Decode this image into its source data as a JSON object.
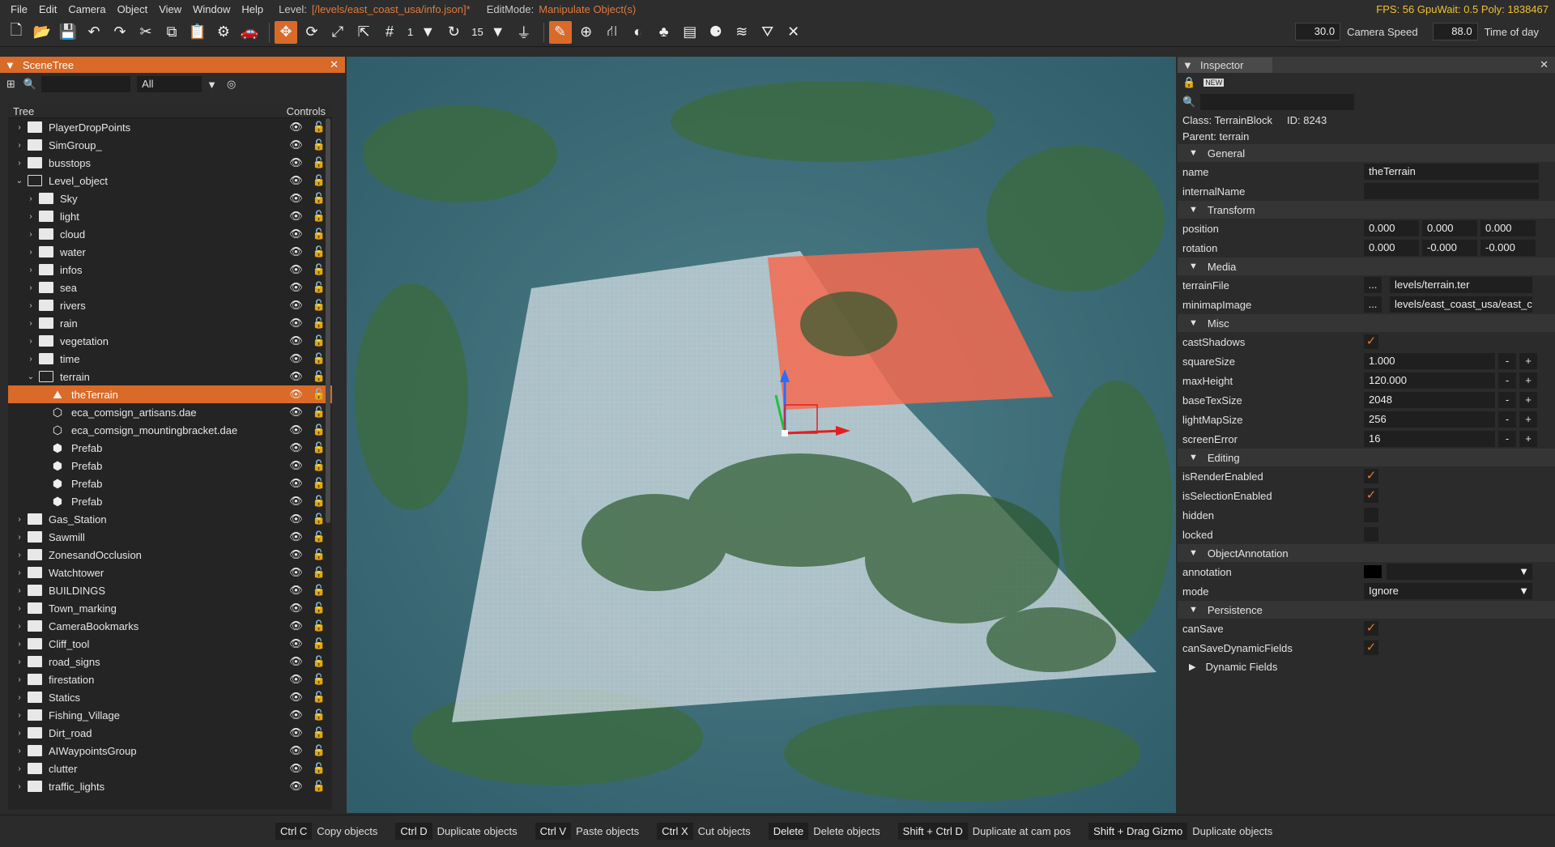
{
  "menu": {
    "items": [
      "File",
      "Edit",
      "Camera",
      "Object",
      "View",
      "Window",
      "Help"
    ],
    "level_label": "Level:",
    "level_path": "[/levels/east_coast_usa/info.json]*",
    "editmode_label": "EditMode:",
    "editmode_value": "Manipulate Object(s)",
    "stats": "FPS: 56  GpuWait: 0.5  Poly: 1838467"
  },
  "toolbar": {
    "snap_value": "1",
    "rot_snap_value": "15",
    "camera_speed_value": "30.0",
    "camera_speed_label": "Camera Speed",
    "time_value": "88.0",
    "time_label": "Time of day"
  },
  "scenetree": {
    "title": "SceneTree",
    "filter": "All",
    "col_tree": "Tree",
    "col_controls": "Controls",
    "rows": [
      {
        "label": "PlayerDropPoints",
        "depth": 0,
        "arrow": "right",
        "icon": "folder"
      },
      {
        "label": "SimGroup_",
        "depth": 0,
        "arrow": "right",
        "icon": "folder"
      },
      {
        "label": "busstops",
        "depth": 0,
        "arrow": "right",
        "icon": "folder"
      },
      {
        "label": "Level_object",
        "depth": 0,
        "arrow": "down",
        "icon": "folder-open"
      },
      {
        "label": "Sky",
        "depth": 1,
        "arrow": "right",
        "icon": "folder"
      },
      {
        "label": "light",
        "depth": 1,
        "arrow": "right",
        "icon": "folder"
      },
      {
        "label": "cloud",
        "depth": 1,
        "arrow": "right",
        "icon": "folder"
      },
      {
        "label": "water",
        "depth": 1,
        "arrow": "right",
        "icon": "folder"
      },
      {
        "label": "infos",
        "depth": 1,
        "arrow": "right",
        "icon": "folder"
      },
      {
        "label": "sea",
        "depth": 1,
        "arrow": "right",
        "icon": "folder"
      },
      {
        "label": "rivers",
        "depth": 1,
        "arrow": "right",
        "icon": "folder"
      },
      {
        "label": "rain",
        "depth": 1,
        "arrow": "right",
        "icon": "folder"
      },
      {
        "label": "vegetation",
        "depth": 1,
        "arrow": "right",
        "icon": "folder"
      },
      {
        "label": "time",
        "depth": 1,
        "arrow": "right",
        "icon": "folder"
      },
      {
        "label": "terrain",
        "depth": 1,
        "arrow": "down",
        "icon": "folder-open"
      },
      {
        "label": "theTerrain",
        "depth": 2,
        "arrow": "",
        "icon": "terrain",
        "selected": true
      },
      {
        "label": "eca_comsign_artisans.dae",
        "depth": 2,
        "arrow": "",
        "icon": "mesh"
      },
      {
        "label": "eca_comsign_mountingbracket.dae",
        "depth": 2,
        "arrow": "",
        "icon": "mesh"
      },
      {
        "label": "Prefab",
        "depth": 2,
        "arrow": "",
        "icon": "prefab"
      },
      {
        "label": "Prefab",
        "depth": 2,
        "arrow": "",
        "icon": "prefab"
      },
      {
        "label": "Prefab",
        "depth": 2,
        "arrow": "",
        "icon": "prefab"
      },
      {
        "label": "Prefab",
        "depth": 2,
        "arrow": "",
        "icon": "prefab"
      },
      {
        "label": "Gas_Station",
        "depth": 0,
        "arrow": "right",
        "icon": "folder"
      },
      {
        "label": "Sawmill",
        "depth": 0,
        "arrow": "right",
        "icon": "folder"
      },
      {
        "label": "ZonesandOcclusion",
        "depth": 0,
        "arrow": "right",
        "icon": "folder"
      },
      {
        "label": "Watchtower",
        "depth": 0,
        "arrow": "right",
        "icon": "folder"
      },
      {
        "label": "BUILDINGS",
        "depth": 0,
        "arrow": "right",
        "icon": "folder"
      },
      {
        "label": "Town_marking",
        "depth": 0,
        "arrow": "right",
        "icon": "folder"
      },
      {
        "label": "CameraBookmarks",
        "depth": 0,
        "arrow": "right",
        "icon": "folder"
      },
      {
        "label": "Cliff_tool",
        "depth": 0,
        "arrow": "right",
        "icon": "folder"
      },
      {
        "label": "road_signs",
        "depth": 0,
        "arrow": "right",
        "icon": "folder"
      },
      {
        "label": "firestation",
        "depth": 0,
        "arrow": "right",
        "icon": "folder"
      },
      {
        "label": "Statics",
        "depth": 0,
        "arrow": "right",
        "icon": "folder"
      },
      {
        "label": "Fishing_Village",
        "depth": 0,
        "arrow": "right",
        "icon": "folder"
      },
      {
        "label": "Dirt_road",
        "depth": 0,
        "arrow": "right",
        "icon": "folder"
      },
      {
        "label": "AIWaypointsGroup",
        "depth": 0,
        "arrow": "right",
        "icon": "folder"
      },
      {
        "label": "clutter",
        "depth": 0,
        "arrow": "right",
        "icon": "folder"
      },
      {
        "label": "traffic_lights",
        "depth": 0,
        "arrow": "right",
        "icon": "folder"
      }
    ]
  },
  "inspector": {
    "title": "Inspector",
    "class_line": "Class: TerrainBlock",
    "id_line": "ID: 8243",
    "parent_line": "Parent: terrain",
    "sections": {
      "general": "General",
      "transform": "Transform",
      "media": "Media",
      "misc": "Misc",
      "editing": "Editing",
      "objectannotation": "ObjectAnnotation",
      "persistence": "Persistence",
      "dynamic": "Dynamic Fields"
    },
    "fields": {
      "name_k": "name",
      "name_v": "theTerrain",
      "internalName_k": "internalName",
      "internalName_v": "",
      "position_k": "position",
      "position_v": [
        "0.000",
        "0.000",
        "0.000"
      ],
      "rotation_k": "rotation",
      "rotation_v": [
        "0.000",
        "-0.000",
        "-0.000"
      ],
      "terrainFile_k": "terrainFile",
      "terrainFile_v": "levels/terrain.ter",
      "minimapImage_k": "minimapImage",
      "minimapImage_v": "levels/east_coast_usa/east_co",
      "castShadows_k": "castShadows",
      "squareSize_k": "squareSize",
      "squareSize_v": "1.000",
      "maxHeight_k": "maxHeight",
      "maxHeight_v": "120.000",
      "baseTexSize_k": "baseTexSize",
      "baseTexSize_v": "2048",
      "lightMapSize_k": "lightMapSize",
      "lightMapSize_v": "256",
      "screenError_k": "screenError",
      "screenError_v": "16",
      "isRenderEnabled_k": "isRenderEnabled",
      "isSelectionEnabled_k": "isSelectionEnabled",
      "hidden_k": "hidden",
      "locked_k": "locked",
      "annotation_k": "annotation",
      "mode_k": "mode",
      "mode_v": "Ignore",
      "canSave_k": "canSave",
      "canSaveDynamicFields_k": "canSaveDynamicFields"
    },
    "ellipsis": "...",
    "minus": "-",
    "plus": "+",
    "check": "✓"
  },
  "statusbar": [
    {
      "key": "Ctrl C",
      "action": "Copy objects"
    },
    {
      "key": "Ctrl D",
      "action": "Duplicate objects"
    },
    {
      "key": "Ctrl V",
      "action": "Paste objects"
    },
    {
      "key": "Ctrl X",
      "action": "Cut objects"
    },
    {
      "key": "Delete",
      "action": "Delete objects"
    },
    {
      "key": "Shift + Ctrl D",
      "action": "Duplicate at cam pos"
    },
    {
      "key": "Shift + Drag Gizmo",
      "action": "Duplicate objects"
    }
  ],
  "colors": {
    "accent": "#d96a28",
    "check": "#e87a2e",
    "stats": "#f0c030"
  }
}
